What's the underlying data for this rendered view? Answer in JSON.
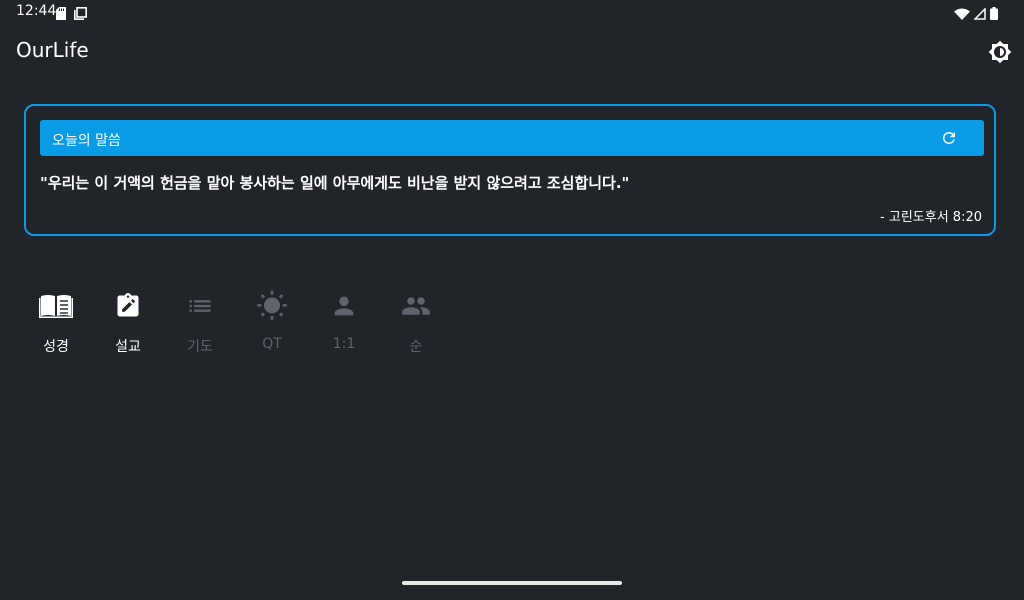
{
  "status_bar": {
    "time": "12:44"
  },
  "app_bar": {
    "title": "OurLife"
  },
  "verse_card": {
    "header": "오늘의 말씀",
    "text": "\"우리는 이 거액의 헌금을 맡아 봉사하는 일에 아무에게도 비난을 받지 않으려고 조심합니다.\"",
    "reference": "- 고린도후서 8:20"
  },
  "menu": {
    "items": [
      {
        "label": "성경",
        "icon": "book-icon",
        "active": true
      },
      {
        "label": "설교",
        "icon": "assignment-edit-icon",
        "active": true
      },
      {
        "label": "기도",
        "icon": "list-icon",
        "active": false
      },
      {
        "label": "QT",
        "icon": "sun-icon",
        "active": false
      },
      {
        "label": "1:1",
        "icon": "person-icon",
        "active": false
      },
      {
        "label": "순",
        "icon": "people-icon",
        "active": false
      }
    ]
  },
  "colors": {
    "background": "#212429",
    "accent": "#0a9be6",
    "inactive": "#5f636b"
  }
}
